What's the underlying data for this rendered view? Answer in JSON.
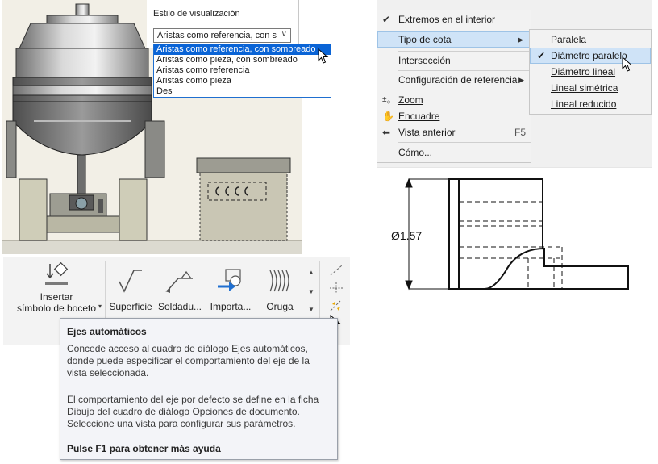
{
  "visual_style": {
    "label": "Estilo de visualización",
    "selected": "Aristas como referencia, con sombreado",
    "selected_display": "Aristas como referencia, con s",
    "options": [
      "Aristas como referencia, con sombreado",
      "Aristas como pieza, con sombreado",
      "Aristas como referencia",
      "Aristas como pieza",
      "Des"
    ]
  },
  "ribbon": {
    "insert_sketch_symbol": {
      "line1": "Insertar",
      "line2": "símbolo de boceto"
    },
    "gallery": [
      "Superficie",
      "Soldadu...",
      "Importa...",
      "Oruga"
    ]
  },
  "tooltip": {
    "title": "Ejes automáticos",
    "para1": "Concede acceso al cuadro de diálogo Ejes automáticos, donde puede especificar el comportamiento del eje de la vista seleccionada.",
    "para2": "El comportamiento del eje por defecto se define en la ficha Dibujo del cuadro de diálogo Opciones de documento. Seleccione una vista para configurar sus parámetros.",
    "help": "Pulse F1 para obtener más ayuda"
  },
  "context_menu": {
    "items": [
      {
        "label": "Extremos en el interior",
        "icon": "check-icon"
      },
      {
        "label": "Tipo de cota",
        "submenu": true
      },
      {
        "label": "Intersección"
      },
      {
        "label": "Configuración de referencia",
        "submenu": true
      },
      {
        "label": "Zoom",
        "icon": "zoom-icon"
      },
      {
        "label": "Encuadre",
        "icon": "pan-hand-icon"
      },
      {
        "label": "Vista anterior",
        "icon": "previous-view-icon",
        "shortcut": "F5"
      },
      {
        "label": "Cómo..."
      }
    ],
    "submenu_items": [
      {
        "label": "Paralela"
      },
      {
        "label": "Diámetro paralelo",
        "checked": true
      },
      {
        "label": "Diámetro lineal"
      },
      {
        "label": "Lineal simétrica"
      },
      {
        "label": "Lineal reducido"
      }
    ]
  },
  "drawing": {
    "dimension_label": "Ø1.57"
  },
  "colors": {
    "selection": "#0a64d6",
    "menu_highlight": "#cfe3f7",
    "accent_blue": "#1f6fd0"
  }
}
